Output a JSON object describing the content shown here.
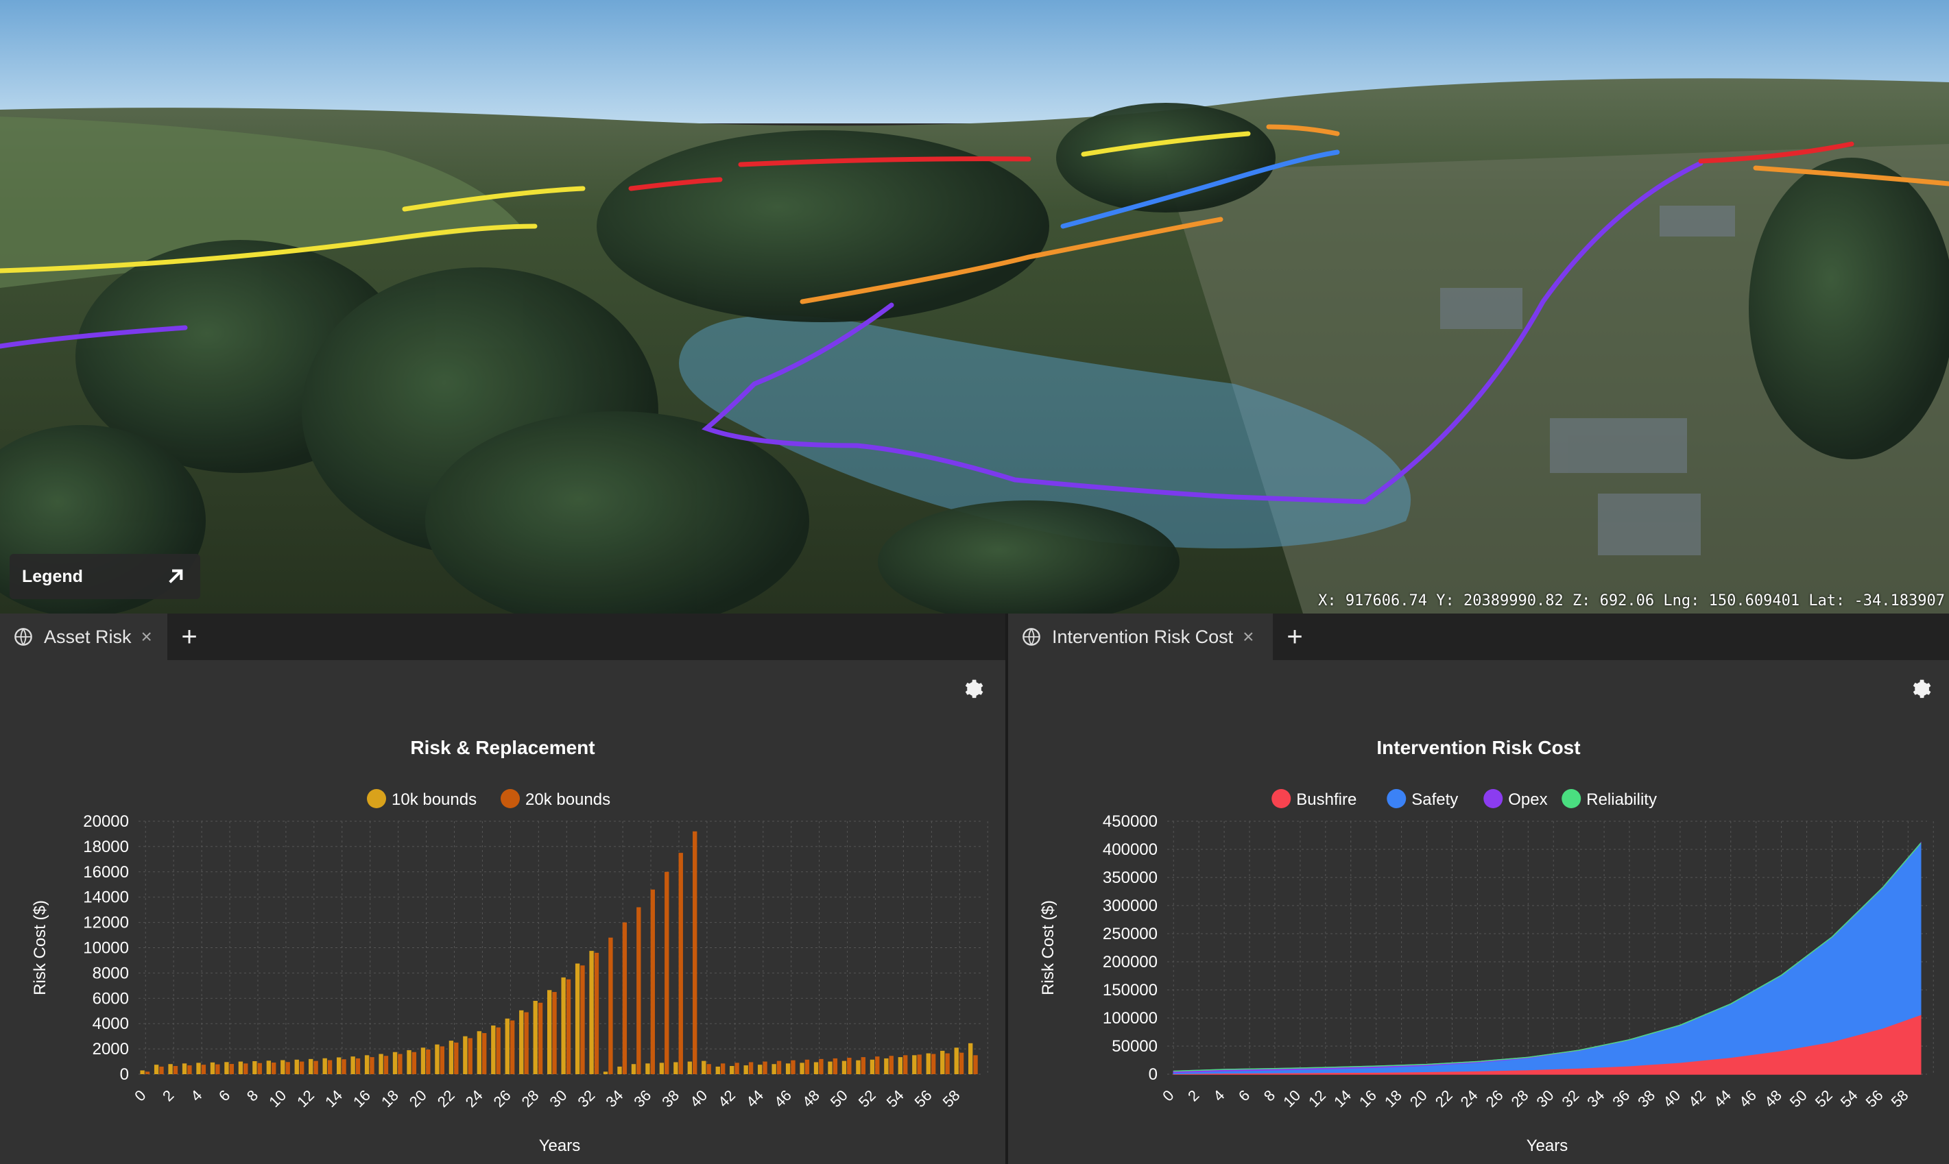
{
  "map": {
    "legend_label": "Legend",
    "coordinates": "X: 917606.74 Y: 20389990.82 Z: 692.06 Lng: 150.609401 Lat: -34.183907"
  },
  "left_panel": {
    "tab_label": "Asset Risk",
    "close_symbol": "×",
    "add_symbol": "+"
  },
  "right_panel": {
    "tab_label": "Intervention Risk Cost",
    "close_symbol": "×",
    "add_symbol": "+"
  },
  "icons": {
    "tab": "globe-icon",
    "settings": "gear-icon",
    "legend_expand": "arrow-up-right-icon"
  },
  "chart_data": [
    {
      "type": "bar",
      "title": "Risk & Replacement",
      "xlabel": "Years",
      "ylabel": "Risk Cost ($)",
      "ylim": [
        0,
        20000
      ],
      "yticks": [
        0,
        2000,
        4000,
        6000,
        8000,
        10000,
        12000,
        14000,
        16000,
        18000,
        20000
      ],
      "xtick_labels": [
        "0",
        "2",
        "4",
        "6",
        "8",
        "10",
        "12",
        "14",
        "16",
        "18",
        "20",
        "22",
        "24",
        "26",
        "28",
        "30",
        "32",
        "34",
        "36",
        "38",
        "40",
        "42",
        "44",
        "46",
        "48",
        "50",
        "52",
        "54",
        "56",
        "58"
      ],
      "grid": true,
      "legend_position": "top-center",
      "categories": [
        0,
        1,
        2,
        3,
        4,
        5,
        6,
        7,
        8,
        9,
        10,
        11,
        12,
        13,
        14,
        15,
        16,
        17,
        18,
        19,
        20,
        21,
        22,
        23,
        24,
        25,
        26,
        27,
        28,
        29,
        30,
        31,
        32,
        33,
        34,
        35,
        36,
        37,
        38,
        39,
        40,
        41,
        42,
        43,
        44,
        45,
        46,
        47,
        48,
        49,
        50,
        51,
        52,
        53,
        54,
        55,
        56,
        57,
        58,
        59
      ],
      "series": [
        {
          "name": "10k bounds",
          "color": "#d9a21b",
          "values": [
            300,
            750,
            800,
            850,
            900,
            930,
            960,
            1000,
            1030,
            1070,
            1110,
            1150,
            1200,
            1260,
            1330,
            1400,
            1500,
            1600,
            1750,
            1900,
            2100,
            2350,
            2650,
            3000,
            3400,
            3850,
            4400,
            5050,
            5800,
            6650,
            7650,
            8750,
            9750,
            200,
            600,
            800,
            850,
            900,
            950,
            1000,
            1050,
            600,
            650,
            700,
            750,
            800,
            850,
            900,
            950,
            1000,
            1050,
            1100,
            1150,
            1250,
            1350,
            1500,
            1650,
            1850,
            2100,
            2450
          ]
        },
        {
          "name": "20k bounds",
          "color": "#c85a0c",
          "values": [
            200,
            600,
            650,
            700,
            750,
            780,
            810,
            850,
            880,
            920,
            960,
            1000,
            1050,
            1110,
            1180,
            1250,
            1350,
            1450,
            1600,
            1750,
            1950,
            2200,
            2500,
            2850,
            3250,
            3700,
            4250,
            4900,
            5650,
            6500,
            7500,
            8600,
            9600,
            10800,
            12000,
            13200,
            14600,
            16000,
            17500,
            19200,
            800,
            850,
            900,
            950,
            1000,
            1050,
            1100,
            1150,
            1200,
            1250,
            1300,
            1350,
            1400,
            1450,
            1500,
            1550,
            1600,
            1650,
            1700,
            1500
          ]
        }
      ]
    },
    {
      "type": "area",
      "stacked": true,
      "title": "Intervention Risk Cost",
      "xlabel": "Years",
      "ylabel": "Risk Cost ($)",
      "ylim": [
        0,
        450000
      ],
      "yticks": [
        0,
        50000,
        100000,
        150000,
        200000,
        250000,
        300000,
        350000,
        400000,
        450000
      ],
      "xtick_labels": [
        "0",
        "2",
        "4",
        "6",
        "8",
        "10",
        "12",
        "14",
        "16",
        "18",
        "20",
        "22",
        "24",
        "26",
        "28",
        "30",
        "32",
        "34",
        "36",
        "38",
        "40",
        "42",
        "44",
        "46",
        "48",
        "50",
        "52",
        "54",
        "56",
        "58"
      ],
      "grid": true,
      "legend_position": "top-center",
      "x": [
        0,
        4,
        8,
        12,
        16,
        20,
        24,
        28,
        32,
        36,
        40,
        44,
        48,
        52,
        56,
        59
      ],
      "series": [
        {
          "name": "Bushfire",
          "color": "#f7434f",
          "values": [
            1000,
            2000,
            2500,
            3000,
            3500,
            4500,
            6000,
            8000,
            11000,
            15000,
            21000,
            30000,
            42000,
            58000,
            82000,
            106000
          ]
        },
        {
          "name": "Safety",
          "color": "#3b82f6",
          "values": [
            2000,
            4000,
            5000,
            6500,
            8500,
            11000,
            15000,
            21000,
            31000,
            46000,
            66000,
            95000,
            134000,
            186000,
            250000,
            305000
          ]
        },
        {
          "name": "Opex",
          "color": "#8b3cf0",
          "values": [
            2500,
            2500,
            2500,
            2500,
            2500,
            2000,
            1500,
            1000,
            500,
            300,
            200,
            100,
            100,
            100,
            100,
            100
          ]
        },
        {
          "name": "Reliability",
          "color": "#4ade80",
          "values": [
            0,
            0,
            0,
            0,
            0,
            0,
            0,
            0,
            0,
            0,
            0,
            0,
            0,
            0,
            0,
            0
          ]
        }
      ]
    }
  ]
}
